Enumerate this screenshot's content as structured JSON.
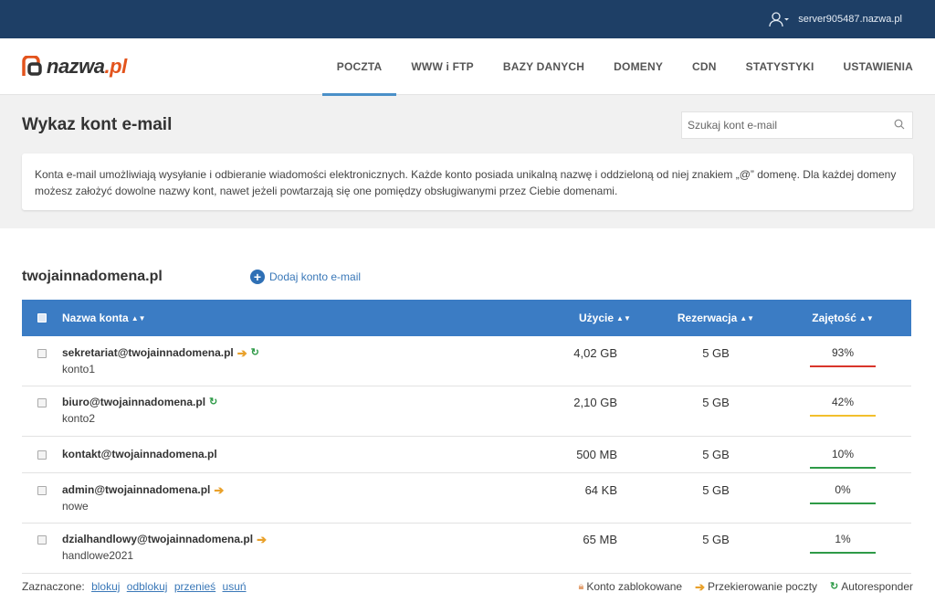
{
  "topbar": {
    "server": "server905487.nazwa.pl"
  },
  "brand": {
    "logo_main": "nazwa",
    "logo_tld": ".pl"
  },
  "nav": [
    "POCZTA",
    "WWW i FTP",
    "BAZY DANYCH",
    "DOMENY",
    "CDN",
    "STATYSTYKI",
    "USTAWIENIA"
  ],
  "page": {
    "title": "Wykaz kont e-mail",
    "search_placeholder": "Szukaj kont e-mail",
    "info": "Konta e-mail umożliwiają wysyłanie i odbieranie wiadomości elektronicznych. Każde konto posiada unikalną nazwę i oddzieloną od niej znakiem „@” domenę. Dla każdej domeny możesz założyć dowolne nazwy kont, nawet jeżeli powtarzają się one pomiędzy obsługiwanymi przez Ciebie domenami."
  },
  "domain": {
    "name": "twojainnadomena.pl",
    "add_label": "Dodaj konto e-mail"
  },
  "table": {
    "headers": {
      "name": "Nazwa konta",
      "usage": "Użycie",
      "reservation": "Rezerwacja",
      "occupancy": "Zajętość"
    },
    "rows": [
      {
        "email": "sekretariat@twojainnadomena.pl",
        "label": "konto1",
        "usage": "4,02  GB",
        "reservation": "5 GB",
        "percent": "93%",
        "level": 0.93,
        "bar_color": "#d9352b",
        "forward": true,
        "autoresponder": true
      },
      {
        "email": "biuro@twojainnadomena.pl",
        "label": "konto2",
        "usage": "2,10  GB",
        "reservation": "5 GB",
        "percent": "42%",
        "level": 0.42,
        "bar_color": "#f2bf2c",
        "forward": false,
        "autoresponder": true
      },
      {
        "email": "kontakt@twojainnadomena.pl",
        "label": "",
        "usage": "500 MB",
        "reservation": "5 GB",
        "percent": "10%",
        "level": 0.1,
        "bar_color": "#2e9a47",
        "forward": false,
        "autoresponder": false
      },
      {
        "email": "admin@twojainnadomena.pl",
        "label": "nowe",
        "usage": "64  KB",
        "reservation": "5 GB",
        "percent": "0%",
        "level": 0.0,
        "bar_color": "#2e9a47",
        "forward": true,
        "autoresponder": false
      },
      {
        "email": "dzialhandlowy@twojainnadomena.pl",
        "label": "handlowe2021",
        "usage": "65 MB",
        "reservation": "5 GB",
        "percent": "1%",
        "level": 0.01,
        "bar_color": "#2e9a47",
        "forward": true,
        "autoresponder": false
      }
    ]
  },
  "footer": {
    "selected_label": "Zaznaczone:",
    "actions": [
      "blokuj",
      "odblokuj",
      "przenieś",
      "usuń"
    ],
    "legend": {
      "locked": "Konto zablokowane",
      "forward": "Przekierowanie poczty",
      "autoresponder": "Autoresponder"
    }
  },
  "colors": {
    "topbar": "#1e3f66",
    "table_header": "#3b7cc4",
    "link": "#3a78b8",
    "forward_icon": "#e9a12b",
    "autoresponder_icon": "#2e9a47",
    "brand_accent": "#e3541d"
  },
  "icons": {
    "user": "user-icon",
    "search": "search-icon",
    "add": "plus-circle-icon",
    "forward": "arrow-right-icon",
    "autoresponder": "refresh-icon",
    "lock": "lock-icon"
  }
}
